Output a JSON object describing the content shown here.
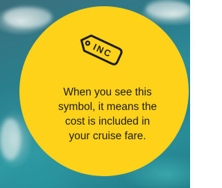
{
  "badge": {
    "icon": "price-tag-icon",
    "icon_text": "INC",
    "message": "When you see this symbol, it means the cost is included in your cruise fare.",
    "color": "#ffd21a"
  },
  "background": {
    "description_color": "#2a7f8d"
  }
}
